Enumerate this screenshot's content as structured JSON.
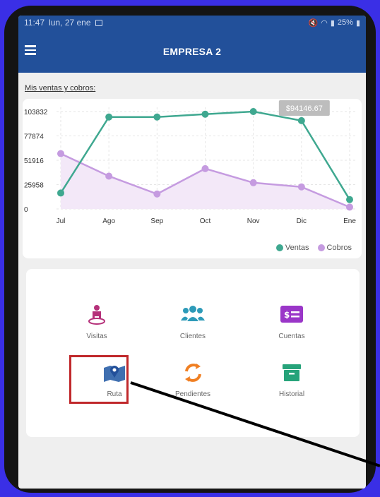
{
  "status_bar": {
    "time": "11:47",
    "date": "lun, 27 ene",
    "battery": "25%"
  },
  "app_bar": {
    "title": "EMPRESA 2"
  },
  "section_title": "Mis ventas y cobros:",
  "chart_data": {
    "type": "line",
    "categories": [
      "Jul",
      "Ago",
      "Sep",
      "Oct",
      "Nov",
      "Dic",
      "Ene"
    ],
    "series": [
      {
        "name": "Ventas",
        "color": "#3fa890",
        "values": [
          17000,
          98000,
          98000,
          101000,
          103832,
          94146.67,
          10000
        ]
      },
      {
        "name": "Cobros",
        "color": "#c59be0",
        "values": [
          59000,
          35000,
          16000,
          43000,
          28000,
          23500,
          2000
        ]
      }
    ],
    "y_ticks": [
      "103832",
      "77874",
      "51916",
      "25958",
      "0"
    ],
    "ylim": [
      0,
      103832
    ],
    "tooltip": "$94146.67",
    "legend_position": "bottom-right",
    "grid": true
  },
  "menu": {
    "visitas": "Visitas",
    "clientes": "Clientes",
    "cuentas": "Cuentas",
    "ruta": "Ruta",
    "pendientes": "Pendientes",
    "historial": "Historial"
  }
}
